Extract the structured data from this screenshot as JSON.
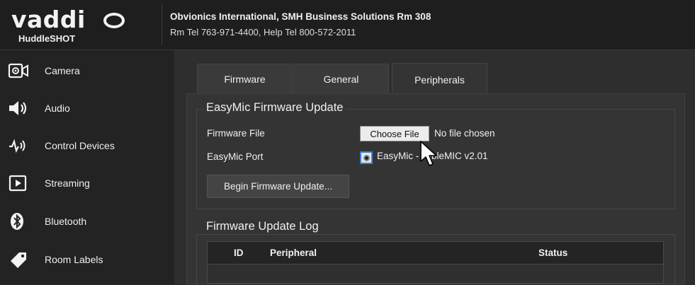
{
  "header": {
    "brand": "vaddi",
    "product": "HuddleSHOT",
    "org": "Obvionics International, SMH Business Solutions Rm 308",
    "tel": "Rm Tel 763-971-4400, Help Tel 800-572-2011"
  },
  "sidebar": {
    "items": [
      {
        "label": "Camera",
        "icon": "camera-icon"
      },
      {
        "label": "Audio",
        "icon": "speaker-icon"
      },
      {
        "label": "Control Devices",
        "icon": "control-devices-icon"
      },
      {
        "label": "Streaming",
        "icon": "play-icon"
      },
      {
        "label": "Bluetooth",
        "icon": "bluetooth-icon"
      },
      {
        "label": "Room Labels",
        "icon": "tag-icon"
      }
    ]
  },
  "tabs": [
    {
      "label": "Firmware"
    },
    {
      "label": "General"
    },
    {
      "label": "Peripherals",
      "active": true
    }
  ],
  "easymic": {
    "legend": "EasyMic Firmware Update",
    "file_label": "Firmware File",
    "choose_button": "Choose File",
    "no_file": "No file chosen",
    "port_label": "EasyMic Port",
    "port_option": "EasyMic - TableMIC v2.01",
    "begin_button": "Begin Firmware Update..."
  },
  "log": {
    "legend": "Firmware Update Log",
    "columns": [
      "ID",
      "Peripheral",
      "Status"
    ]
  },
  "colors": {
    "accent": "#3d7edb",
    "background": "#2b2b2b",
    "sidebar": "#232323"
  }
}
